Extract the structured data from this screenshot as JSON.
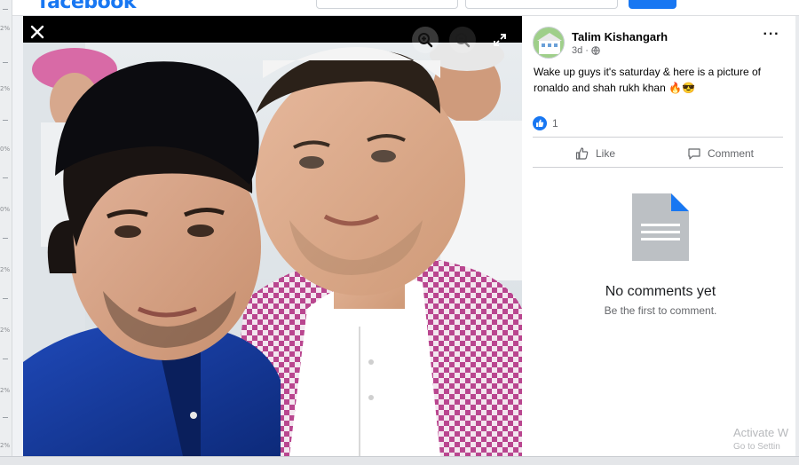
{
  "app": {
    "logo_text": "facebook"
  },
  "ruler": {
    "labels": [
      "2%",
      "2%",
      "0%",
      "0%",
      "2%",
      "2%",
      "2%",
      "2%"
    ]
  },
  "viewer": {
    "close_icon": "close-icon",
    "zoom_in_icon": "zoom-in-icon",
    "zoom_out_icon": "zoom-out-icon",
    "fullscreen_icon": "fullscreen-icon"
  },
  "post": {
    "author": "Talim Kishangarh",
    "time": "3d",
    "audience_icon": "globe-icon",
    "text": "Wake up guys it's saturday & here is a picture of ronaldo and shah rukh khan 🔥😎",
    "reaction_count": "1",
    "reaction_icon": "like-reaction-icon"
  },
  "actions": {
    "like_label": "Like",
    "comment_label": "Comment"
  },
  "comments": {
    "empty_title": "No comments yet",
    "empty_subtitle": "Be the first to comment."
  },
  "watermark": {
    "line1": "Activate W",
    "line2": "Go to Settin"
  },
  "colors": {
    "brand": "#1877f2",
    "viewer_bg": "#000000",
    "panel_bg": "#ffffff",
    "doc_icon": "#bcc0c4"
  }
}
